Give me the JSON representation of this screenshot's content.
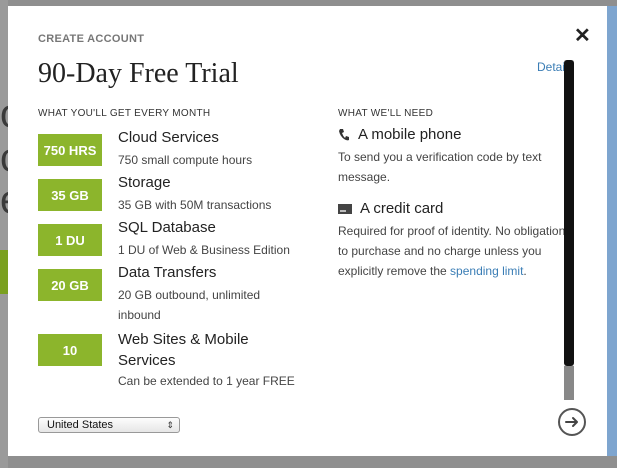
{
  "dialog": {
    "eyebrow": "CREATE ACCOUNT",
    "title": "90-Day Free Trial",
    "details_link": "Details"
  },
  "left_section": {
    "heading": "WHAT YOU'LL GET EVERY MONTH",
    "items": [
      {
        "badge": "750 HRS",
        "title": "Cloud Services",
        "desc": "750 small compute hours"
      },
      {
        "badge": "35 GB",
        "title": "Storage",
        "desc": "35 GB with 50M transactions"
      },
      {
        "badge": "1 DU",
        "title": "SQL Database",
        "desc": "1 DU of Web & Business Edition"
      },
      {
        "badge": "20 GB",
        "title": "Data Transfers",
        "desc": "20 GB outbound, unlimited inbound"
      },
      {
        "badge": "10",
        "title": "Web Sites & Mobile Services",
        "desc": "Can be extended to 1 year FREE"
      }
    ]
  },
  "right_section": {
    "heading": "WHAT WE'LL NEED",
    "needs": [
      {
        "title": "A mobile phone",
        "desc": "To send you a verification code by text message.",
        "icon": "phone-icon"
      },
      {
        "title": "A credit card",
        "desc_prefix": "Required for proof of identity. No obligation to purchase and no charge unless you explicitly remove the ",
        "link_text": "spending limit",
        "desc_suffix": ".",
        "icon": "credit-card-icon"
      }
    ]
  },
  "footer": {
    "country_selected": "United States"
  },
  "colors": {
    "badge_green": "#8cb52c",
    "link_blue": "#3a7db5"
  }
}
